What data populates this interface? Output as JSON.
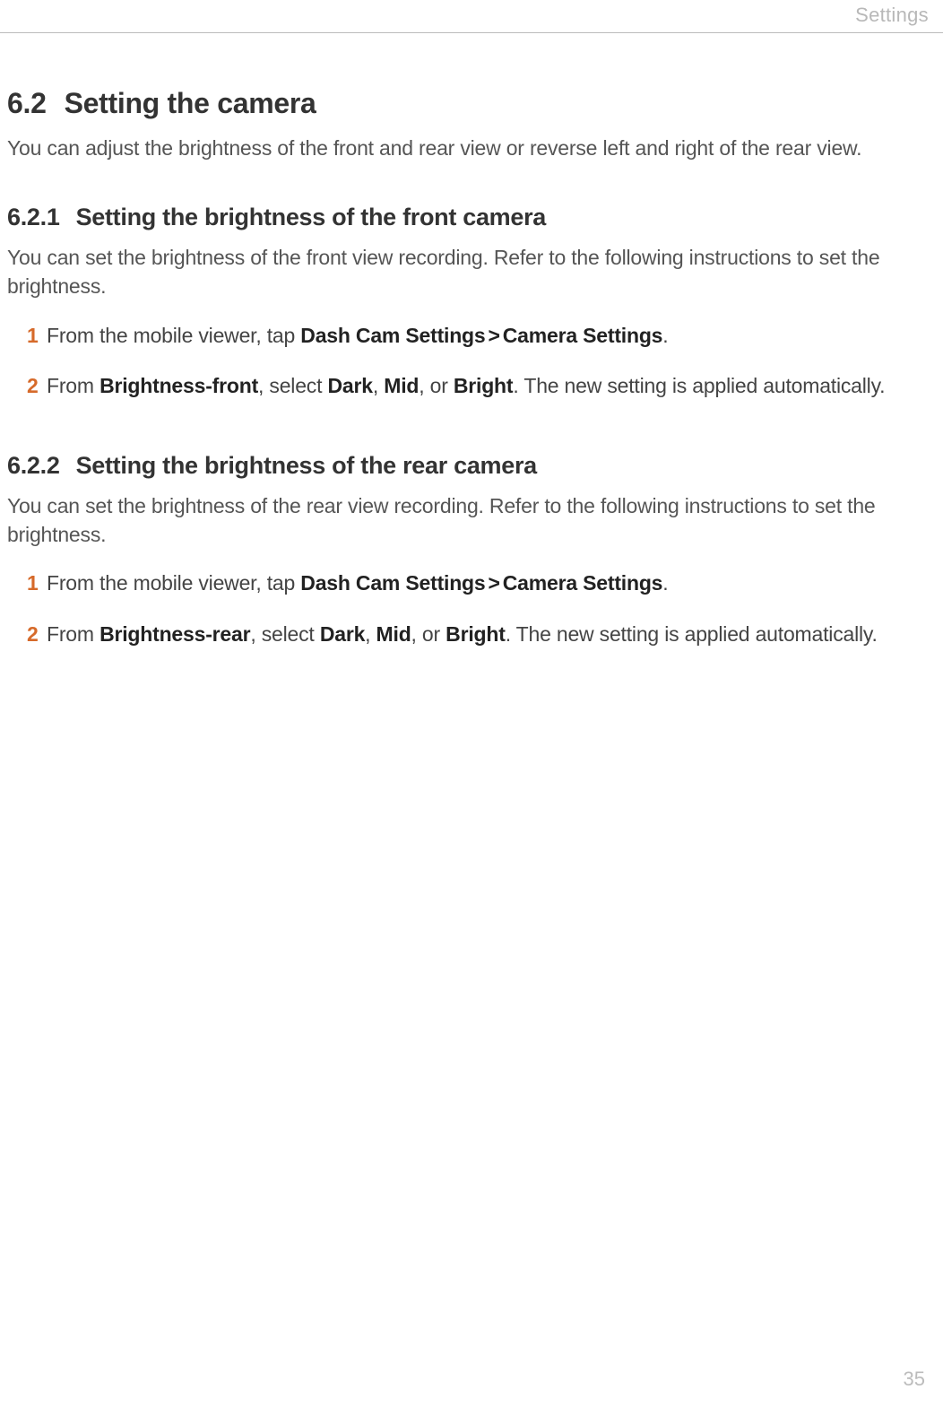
{
  "header": {
    "label": "Settings"
  },
  "section": {
    "number": "6.2",
    "title": "Setting the camera",
    "intro": "You can adjust the brightness of the front and rear view or reverse left and right of the rear view."
  },
  "sub1": {
    "number": "6.2.1",
    "title": "Setting the brightness of the front camera",
    "desc": "You can set the brightness of the front view recording. Refer to the following instructions to set the brightness.",
    "step1": {
      "num": "1",
      "pre": "From the mobile viewer, tap ",
      "b1": "Dash Cam Settings",
      "b2": "Camera Settings",
      "post": "."
    },
    "step2": {
      "num": "2",
      "pre": "From ",
      "b1": "Brightness-front",
      "mid1": ", select ",
      "b2": "Dark",
      "mid2": ", ",
      "b3": "Mid",
      "mid3": ", or ",
      "b4": "Bright",
      "post": ". The new setting is applied automatically."
    }
  },
  "sub2": {
    "number": "6.2.2",
    "title": "Setting the brightness of the rear camera",
    "desc": "You can set the brightness of the rear view recording. Refer to the following instructions to set the brightness.",
    "step1": {
      "num": "1",
      "pre": "From the mobile viewer, tap ",
      "b1": "Dash Cam Settings",
      "b2": "Camera Settings",
      "post": "."
    },
    "step2": {
      "num": "2",
      "pre": "From ",
      "b1": "Brightness-rear",
      "mid1": ", select ",
      "b2": "Dark",
      "mid2": ", ",
      "b3": "Mid",
      "mid3": ", or ",
      "b4": "Bright",
      "post": ". The new setting is applied automatically."
    }
  },
  "chev": ">",
  "page_number": "35"
}
